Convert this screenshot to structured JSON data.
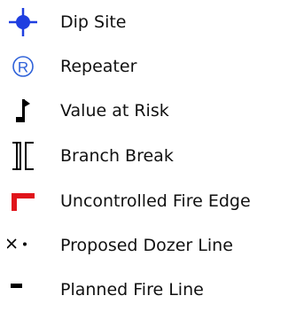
{
  "legend": {
    "items": [
      {
        "icon": "dip-site-icon",
        "label": "Dip Site",
        "color": "#1f3fe0"
      },
      {
        "icon": "repeater-icon",
        "label": "Repeater",
        "glyph": "R",
        "color": "#2f62d9"
      },
      {
        "icon": "value-at-risk-icon",
        "label": "Value at Risk",
        "color": "#000000"
      },
      {
        "icon": "branch-break-icon",
        "label": "Branch Break",
        "color": "#000000"
      },
      {
        "icon": "uncontrolled-fire-edge-icon",
        "label": "Uncontrolled Fire Edge",
        "color": "#e0141b"
      },
      {
        "icon": "proposed-dozer-line-icon",
        "label": "Proposed Dozer Line",
        "color": "#000000"
      },
      {
        "icon": "planned-fire-line-icon",
        "label": "Planned Fire Line",
        "color": "#000000"
      }
    ]
  }
}
